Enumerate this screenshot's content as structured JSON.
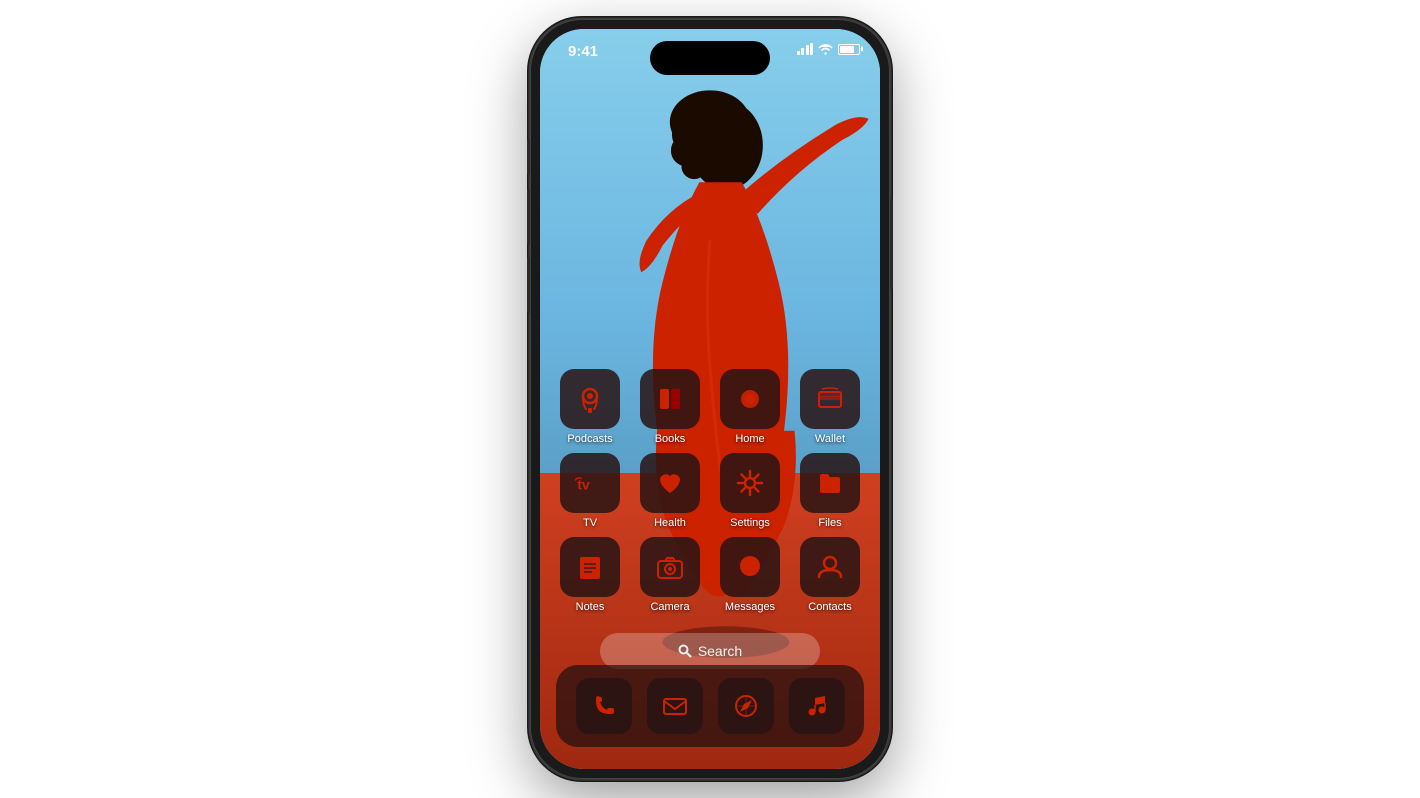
{
  "phone": {
    "status_bar": {
      "time": "9:41",
      "signal_label": "signal",
      "wifi_label": "wifi",
      "battery_label": "battery"
    },
    "apps": {
      "row1": [
        {
          "id": "podcasts",
          "label": "Podcasts",
          "icon": "🎙"
        },
        {
          "id": "books",
          "label": "Books",
          "icon": "📖"
        },
        {
          "id": "home",
          "label": "Home",
          "icon": "🏠"
        },
        {
          "id": "wallet",
          "label": "Wallet",
          "icon": "💳"
        }
      ],
      "row2": [
        {
          "id": "tv",
          "label": "TV",
          "icon": "📺"
        },
        {
          "id": "health",
          "label": "Health",
          "icon": "❤️"
        },
        {
          "id": "settings",
          "label": "Settings",
          "icon": "⚙️"
        },
        {
          "id": "files",
          "label": "Files",
          "icon": "📁"
        }
      ],
      "row3": [
        {
          "id": "notes",
          "label": "Notes",
          "icon": "📝"
        },
        {
          "id": "camera",
          "label": "Camera",
          "icon": "📷"
        },
        {
          "id": "messages",
          "label": "Messages",
          "icon": "💬"
        },
        {
          "id": "contacts",
          "label": "Contacts",
          "icon": "👤"
        }
      ]
    },
    "dock": [
      {
        "id": "phone",
        "label": "Phone",
        "icon": "📞"
      },
      {
        "id": "mail",
        "label": "Mail",
        "icon": "✉️"
      },
      {
        "id": "safari",
        "label": "Safari",
        "icon": "🧭"
      },
      {
        "id": "music",
        "label": "Music",
        "icon": "🎵"
      }
    ],
    "search": {
      "placeholder": "Search"
    }
  }
}
